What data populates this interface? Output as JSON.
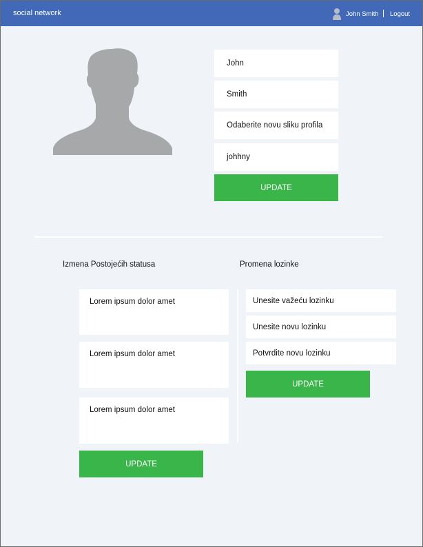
{
  "header": {
    "brand": "social network",
    "user_name": "John Smith",
    "logout_label": "Logout"
  },
  "profile": {
    "first_name": "John",
    "last_name": "Smith",
    "picture_prompt": "Odaberite novu sliku profila",
    "username": "johhny",
    "update_label": "UPDATE"
  },
  "statuses": {
    "heading": "Izmena Postojećih statusa",
    "items": [
      {
        "text": "Lorem ipsum dolor amet"
      },
      {
        "text": "Lorem ipsum dolor amet"
      },
      {
        "text": "Lorem ipsum dolor amet"
      }
    ],
    "update_label": "UPDATE"
  },
  "password": {
    "heading": "Promena lozinke",
    "current_placeholder": "Unesite važeću lozinku",
    "new_placeholder": "Unesite novu lozinku",
    "confirm_placeholder": "Potvrdite novu lozinku",
    "update_label": "UPDATE"
  },
  "colors": {
    "header_bg": "#4169b8",
    "button_bg": "#39b54a",
    "page_bg": "#f0f4f9",
    "avatar": "#a6a8a9"
  },
  "icons": {
    "user": "user-icon",
    "avatar": "avatar-silhouette-icon"
  }
}
